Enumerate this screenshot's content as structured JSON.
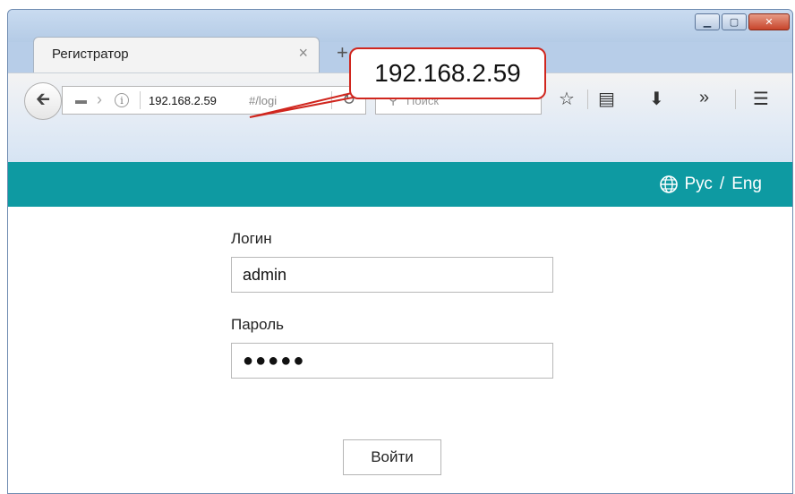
{
  "browser": {
    "tab_title": "Регистратор",
    "tab_close": "×",
    "new_tab": "+",
    "url_host": "192.168.2.59",
    "url_path": "#/logi",
    "search_placeholder": "Поиск",
    "window_controls": [
      "minimize-icon",
      "maximize-icon",
      "close-icon"
    ]
  },
  "callout": {
    "text": "192.168.2.59"
  },
  "header": {
    "lang_ru": "Рус",
    "lang_sep": "/",
    "lang_en": "Eng",
    "accent_color": "#0e9aa2"
  },
  "form": {
    "login_label": "Логин",
    "login_value": "admin",
    "password_label": "Пароль",
    "password_value": "●●●●●",
    "submit_label": "Войти"
  }
}
